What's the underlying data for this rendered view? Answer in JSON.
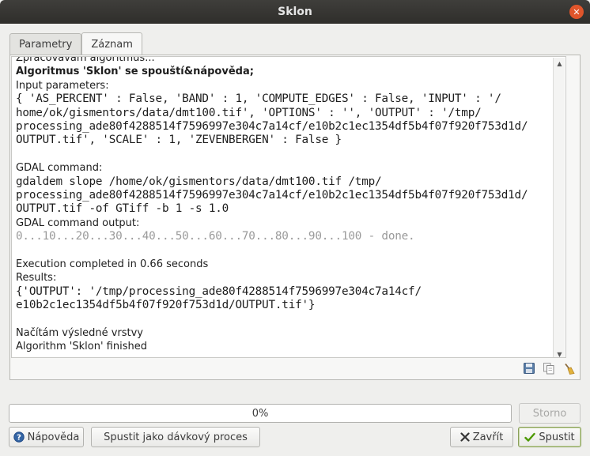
{
  "window": {
    "title": "Sklon"
  },
  "tabs": [
    {
      "label": "Parametry",
      "active": false
    },
    {
      "label": "Záznam",
      "active": true
    }
  ],
  "log": {
    "lines": [
      {
        "text": "Zpracovávám algoritmus...",
        "style": "sans"
      },
      {
        "text": "Algoritmus 'Sklon' se spouští&nápověda;",
        "style": "sans-bold"
      },
      {
        "text": "Input parameters:",
        "style": "sans"
      },
      {
        "text": "{ 'AS_PERCENT' : False, 'BAND' : 1, 'COMPUTE_EDGES' : False, 'INPUT' : '/",
        "style": "mono"
      },
      {
        "text": "home/ok/gismentors/data/dmt100.tif', 'OPTIONS' : '', 'OUTPUT' : '/tmp/",
        "style": "mono"
      },
      {
        "text": "processing_ade80f4288514f7596997e304c7a14cf/e10b2c1ec1354df5b4f07f920f753d1d/",
        "style": "mono"
      },
      {
        "text": "OUTPUT.tif', 'SCALE' : 1, 'ZEVENBERGEN' : False }",
        "style": "mono"
      },
      {
        "text": "",
        "style": "blank"
      },
      {
        "text": "GDAL command:",
        "style": "sans"
      },
      {
        "text": "gdaldem slope /home/ok/gismentors/data/dmt100.tif /tmp/",
        "style": "mono"
      },
      {
        "text": "processing_ade80f4288514f7596997e304c7a14cf/e10b2c1ec1354df5b4f07f920f753d1d/",
        "style": "mono"
      },
      {
        "text": "OUTPUT.tif -of GTiff -b 1 -s 1.0",
        "style": "mono"
      },
      {
        "text": "GDAL command output:",
        "style": "sans"
      },
      {
        "text": "0...10...20...30...40...50...60...70...80...90...100 - done.",
        "style": "mono-gray"
      },
      {
        "text": "",
        "style": "blank"
      },
      {
        "text": "Execution completed in 0.66 seconds",
        "style": "sans"
      },
      {
        "text": "Results:",
        "style": "sans"
      },
      {
        "text": "{'OUTPUT': '/tmp/processing_ade80f4288514f7596997e304c7a14cf/",
        "style": "mono"
      },
      {
        "text": "e10b2c1ec1354df5b4f07f920f753d1d/OUTPUT.tif'}",
        "style": "mono"
      },
      {
        "text": "",
        "style": "blank"
      },
      {
        "text": "Načítám výsledné vrstvy",
        "style": "sans"
      },
      {
        "text": "Algorithm 'Sklon' finished",
        "style": "sans"
      }
    ]
  },
  "log_tools": {
    "save_icon": "save-icon",
    "copy_icon": "copy-icon",
    "clear_icon": "broom-icon"
  },
  "progress": {
    "value": 0,
    "label": "0%"
  },
  "buttons": {
    "cancel": "Storno",
    "help": "Nápověda",
    "batch": "Spustit jako dávkový proces",
    "close": "Zavřít",
    "run": "Spustit"
  },
  "colors": {
    "titlebar": "#2f2e2b",
    "close_button": "#e0552b",
    "run_check": "#4e9a06",
    "close_x": "#333333"
  }
}
